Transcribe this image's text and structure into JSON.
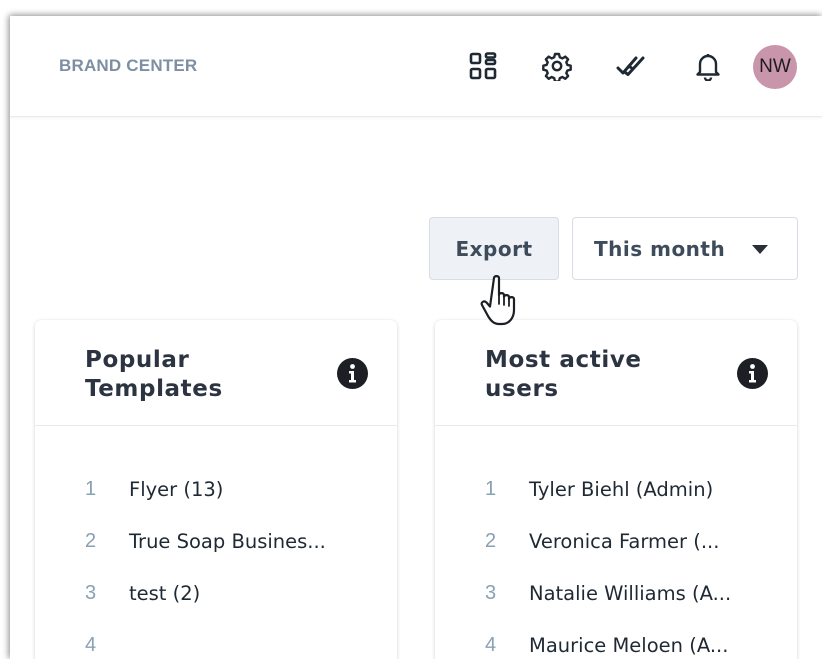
{
  "header": {
    "brand": "BRAND CENTER",
    "avatar_initials": "NW",
    "avatar_color": "#c995ab",
    "icons": [
      "apps-grid-icon",
      "settings-gear-icon",
      "double-check-icon",
      "bell-icon"
    ]
  },
  "toolbar": {
    "export_label": "Export",
    "period_selected": "This month"
  },
  "cards": [
    {
      "title": "Popular Templates",
      "items": [
        {
          "rank": "1",
          "name": "Flyer (13)"
        },
        {
          "rank": "2",
          "name": "True Soap Busines..."
        },
        {
          "rank": "3",
          "name": "test (2)"
        },
        {
          "rank": "4",
          "name": ""
        }
      ]
    },
    {
      "title": "Most active users",
      "items": [
        {
          "rank": "1",
          "name": "Tyler Biehl (Admin)"
        },
        {
          "rank": "2",
          "name": "Veronica Farmer (..."
        },
        {
          "rank": "3",
          "name": "Natalie Williams (A..."
        },
        {
          "rank": "4",
          "name": "Maurice Meloen (A..."
        }
      ]
    }
  ]
}
